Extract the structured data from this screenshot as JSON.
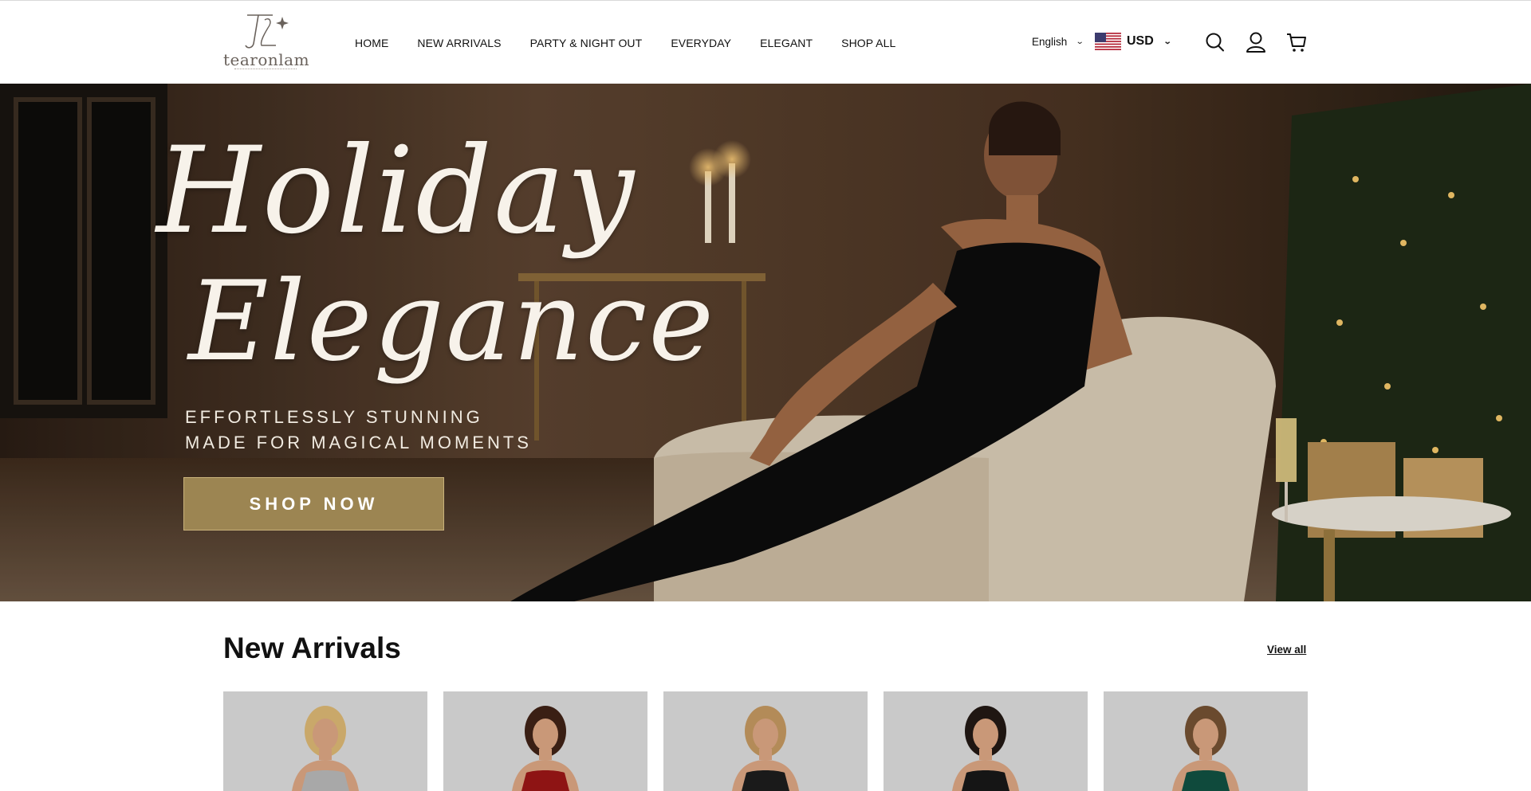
{
  "brand": {
    "logo_text": "tearonlam"
  },
  "nav": {
    "items": [
      {
        "label": "HOME"
      },
      {
        "label": "NEW ARRIVALS"
      },
      {
        "label": "PARTY & NIGHT OUT"
      },
      {
        "label": "EVERYDAY"
      },
      {
        "label": "ELEGANT"
      },
      {
        "label": "SHOP ALL"
      }
    ]
  },
  "header": {
    "language": "English",
    "currency": "USD",
    "icons": [
      "search-icon",
      "account-icon",
      "cart-icon"
    ]
  },
  "hero": {
    "title_line_1": "Holiday",
    "title_line_2": "Elegance",
    "subtitle_line_1": "EFFORTLESSLY STUNNING",
    "subtitle_line_2": "MADE FOR MAGICAL MOMENTS",
    "cta_label": "SHOP NOW",
    "cta_color": "#9c8552"
  },
  "new_arrivals": {
    "title": "New Arrivals",
    "view_all_label": "View all",
    "products": [
      {
        "dress_color": "#a8a8a8",
        "hair_color": "#c9a86a"
      },
      {
        "dress_color": "#8e1414",
        "hair_color": "#3a1f14"
      },
      {
        "dress_color": "#1a1a1a",
        "hair_color": "#b38b58"
      },
      {
        "dress_color": "#151515",
        "hair_color": "#1f1612"
      },
      {
        "dress_color": "#0f4a3c",
        "hair_color": "#6a4a2e"
      }
    ]
  }
}
